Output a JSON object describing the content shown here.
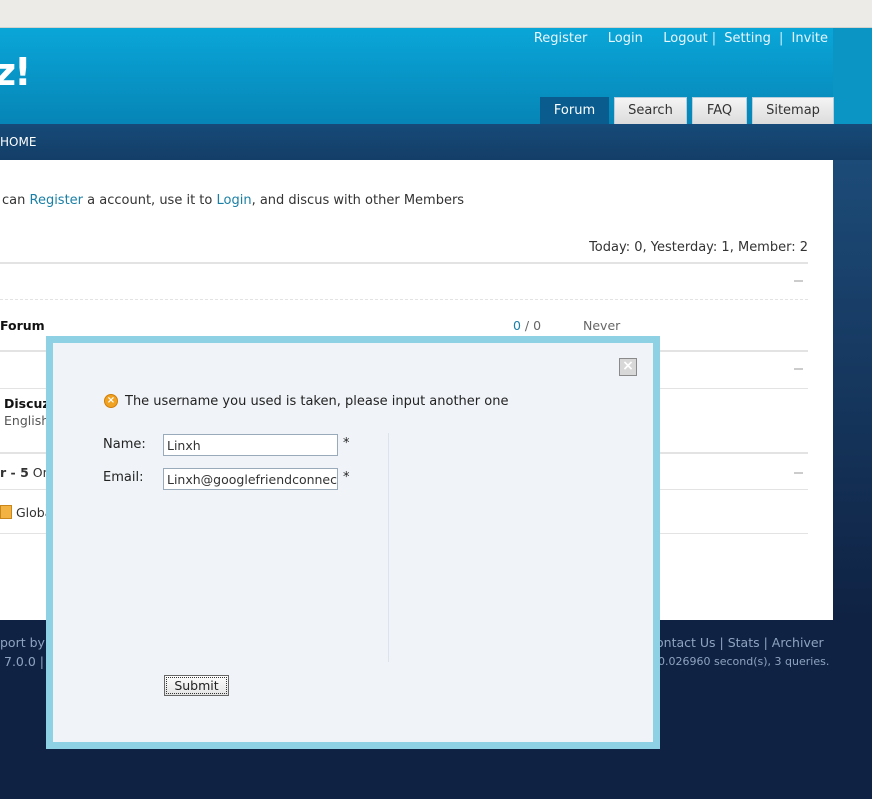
{
  "header": {
    "logo_text": "z!",
    "toplinks": [
      "Register",
      "Login",
      "Logout",
      "Setting",
      "Invite"
    ],
    "tabs": [
      "Forum",
      "Search",
      "FAQ",
      "Sitemap"
    ],
    "active_tab": "Forum"
  },
  "nav": {
    "home": "HOME"
  },
  "content": {
    "welcome_pre": "can ",
    "welcome_register": "Register",
    "welcome_mid": " a account, use it to ",
    "welcome_login": "Login",
    "welcome_post": ", and discus with other Members",
    "stats": "Today: 0, Yesterday: 1, Member: 2",
    "forum_name": "Forum",
    "ratio_left": "0",
    "ratio_sep": " / ",
    "ratio_right": "0",
    "last_post": "Never",
    "partial_row1": "Discuz",
    "partial_row2": "English",
    "partial_row3_a": "r - ",
    "partial_row3_b": "5",
    "partial_row3_c": " On",
    "partial_row4": "Globa"
  },
  "footer": {
    "left1": "port by D",
    "left2": "7.0.0 |",
    "right1": "ontact Us  | Stats | Archiver",
    "right2": "0.026960 second(s), 3 queries."
  },
  "modal": {
    "close_glyph": "×",
    "error": "The username you used is taken, please input another one",
    "name_label": "Name:",
    "name_value": "Linxh",
    "email_label": "Email:",
    "email_value": "Linxh@googlefriendconnect",
    "required": "*",
    "submit_label": "Submit"
  },
  "colors": {
    "header_blue": "#0aa6d8",
    "nav_blue": "#174a78",
    "link": "#1a7fa5",
    "modal_frame": "#8fd1e4"
  }
}
